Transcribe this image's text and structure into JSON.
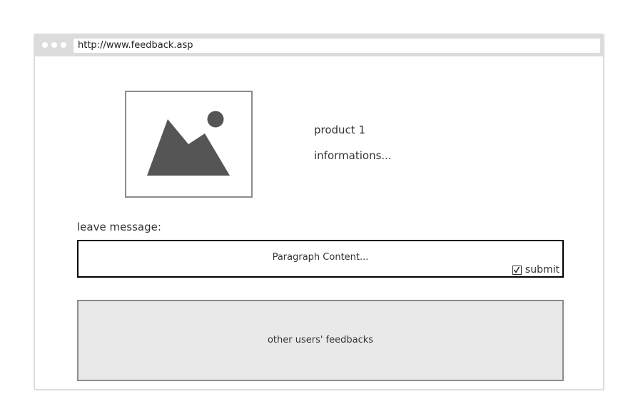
{
  "browser": {
    "url": "http://www.feedback.asp"
  },
  "product": {
    "image_icon": "image-placeholder-icon",
    "name": "product 1",
    "info": "informations..."
  },
  "message": {
    "label": "leave message:",
    "content": "Paragraph Content...",
    "submit_label": "submit",
    "submit_checked": true
  },
  "feedbacks": {
    "label": "other users' feedbacks"
  },
  "colors": {
    "chrome": "#dcdcdc",
    "image_fill": "#555555",
    "feedback_bg": "#e9e9e9"
  }
}
